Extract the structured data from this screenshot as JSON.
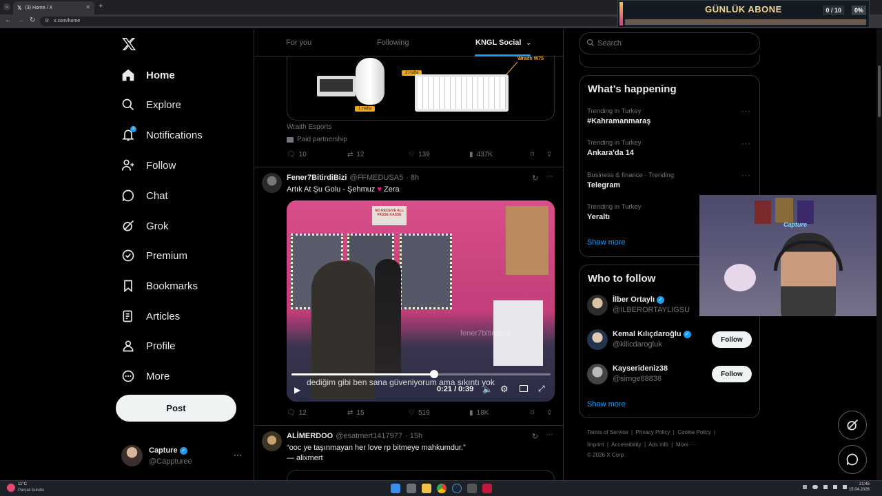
{
  "browser": {
    "tab_title": "(3) Home / X",
    "url": "x.com/home"
  },
  "overlay": {
    "title": "GÜNLÜK ABONE",
    "count": "0 / 10",
    "percent": "0%"
  },
  "nav": {
    "items": [
      {
        "label": "Home",
        "icon": "home-icon"
      },
      {
        "label": "Explore",
        "icon": "search-icon"
      },
      {
        "label": "Notifications",
        "icon": "bell-icon",
        "badge": "3"
      },
      {
        "label": "Follow",
        "icon": "person-add-icon"
      },
      {
        "label": "Chat",
        "icon": "chat-icon"
      },
      {
        "label": "Grok",
        "icon": "grok-icon"
      },
      {
        "label": "Premium",
        "icon": "premium-icon"
      },
      {
        "label": "Bookmarks",
        "icon": "bookmark-icon"
      },
      {
        "label": "Articles",
        "icon": "articles-icon"
      },
      {
        "label": "Profile",
        "icon": "profile-icon"
      },
      {
        "label": "More",
        "icon": "more-circle-icon"
      }
    ],
    "post_label": "Post",
    "account": {
      "name": "Capture",
      "handle": "@Cappturee"
    }
  },
  "feed_tabs": [
    "For you",
    "Following",
    "KNGL Social"
  ],
  "tweets": [
    {
      "ad_labels": [
        "Wraith W75"
      ],
      "product_labels": [
        "2.Hafta",
        "1.Hafta"
      ],
      "source": "Wraith Esports",
      "paid": "Paid partnership",
      "stats": {
        "replies": "10",
        "reposts": "12",
        "likes": "139",
        "views": "437K"
      }
    },
    {
      "name": "Fener7BitirdiBizi",
      "handle": "@FFMEDUSA5",
      "time": "· 8h",
      "text_before": "Artık At Şu Golu - Şehmuz",
      "text_after": "Zera",
      "video": {
        "sign_text": "NO RECEIVE ALL PASSE KASSE",
        "watermark": "fener7bitirdibizi",
        "caption": "dediğim gibi ben sana güveniyorum ama sıkıntı yok",
        "time": "0:21 / 0:39",
        "progress": 0.55
      },
      "stats": {
        "replies": "12",
        "reposts": "15",
        "likes": "519",
        "views": "18K"
      }
    },
    {
      "name": "ALİMERDOO",
      "handle": "@esatmert1417977",
      "time": "· 15h",
      "line1": "“ooc ye taşınmayan her love rp bitmeye mahkumdur.”",
      "line2": "— alixmert"
    }
  ],
  "search": {
    "placeholder": "Search"
  },
  "whats_happening": {
    "title": "What’s happening",
    "trends": [
      {
        "category": "Trending in Turkey",
        "topic": "#Kahramanmaraş"
      },
      {
        "category": "Trending in Turkey",
        "topic": "Ankara'da 14"
      },
      {
        "category": "Business & finance · Trending",
        "topic": "Telegram"
      },
      {
        "category": "Trending in Turkey",
        "topic": "Yeraltı"
      }
    ],
    "show_more": "Show more"
  },
  "who_to_follow": {
    "title": "Who to follow",
    "users": [
      {
        "name": "İlber Ortaylı",
        "handle": "@ILBERORTAYLIGSU",
        "verified": true
      },
      {
        "name": "Kemal Kılıçdaroğlu",
        "handle": "@kilicdarogluk",
        "verified": true,
        "follow": "Follow"
      },
      {
        "name": "Kayserideniz38",
        "handle": "@simge68836",
        "verified": false,
        "follow": "Follow"
      }
    ],
    "show_more": "Show more"
  },
  "footer": {
    "links": [
      "Terms of Service",
      "Privacy Policy",
      "Cookie Policy",
      "Imprint",
      "Accessibility",
      "Ads info",
      "More ···"
    ],
    "copyright": "© 2026 X Corp."
  },
  "webcam": {
    "neon_sign": "Capture"
  },
  "taskbar": {
    "weather_temp": "11°C",
    "weather_desc": "Parçalı bulutlu",
    "time": "21:45",
    "date": "15.04.2026"
  },
  "colors": {
    "accent": "#1d9bf0",
    "background": "#000000",
    "muted": "#71767b"
  }
}
